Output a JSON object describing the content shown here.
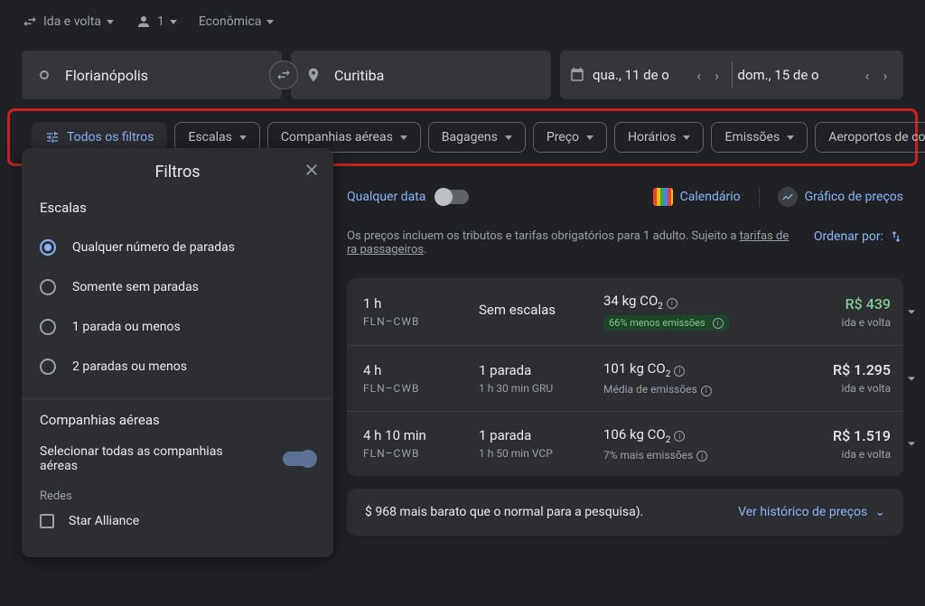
{
  "top": {
    "trip_type": "Ida e volta",
    "passengers": "1",
    "cabin": "Econômica"
  },
  "search": {
    "origin": "Florianópolis",
    "destination": "Curitiba",
    "depart": "qua., 11 de o",
    "return": "dom., 15 de o"
  },
  "filters": {
    "all": "Todos os filtros",
    "chips": [
      "Escalas",
      "Companhias aéreas",
      "Bagagens",
      "Preço",
      "Horários",
      "Emissões",
      "Aeroportos de con"
    ]
  },
  "view": {
    "any_date": "Qualquer data",
    "calendar": "Calendário",
    "price_chart": "Gráfico de preços"
  },
  "notice": {
    "line1": "Os preços incluem os tributos e tarifas obrigatórios para 1 adulto. Sujeito a ",
    "link1": "tarifas de",
    "line2": "ra passageiros",
    "sort": "Ordenar por:"
  },
  "results": [
    {
      "dur": "1 h",
      "route": "FLN–CWB",
      "stops": "Sem escalas",
      "stop_sub": "",
      "co2": "34 kg CO",
      "co2_badge": "66% menos emissões",
      "price": "R$ 439",
      "trip": "ida e volta",
      "green": true
    },
    {
      "dur": "4 h",
      "route": "FLN–CWB",
      "stops": "1 parada",
      "stop_sub": "1 h 30 min GRU",
      "co2": "101 kg CO",
      "co2_sub": "Média de emissões",
      "price": "R$ 1.295",
      "trip": "ida e volta",
      "green": false
    },
    {
      "dur": "4 h 10 min",
      "route": "FLN–CWB",
      "stops": "1 parada",
      "stop_sub": "1 h 50 min VCP",
      "co2": "106 kg CO",
      "co2_sub": "7% mais emissões",
      "price": "R$ 1.519",
      "trip": "ida e volta",
      "green": false
    }
  ],
  "bottom": {
    "text": "$ 968 mais barato que o normal para a pesquisa).",
    "link": "Ver histórico de preços"
  },
  "panel": {
    "title": "Filtros",
    "stops_title": "Escalas",
    "stops_options": [
      "Qualquer número de paradas",
      "Somente sem paradas",
      "1 parada ou menos",
      "2 paradas ou menos"
    ],
    "airlines_title": "Companhias aéreas",
    "select_all": "Selecionar todas as companhias aéreas",
    "networks_label": "Redes",
    "networks": [
      "Star Alliance"
    ]
  }
}
